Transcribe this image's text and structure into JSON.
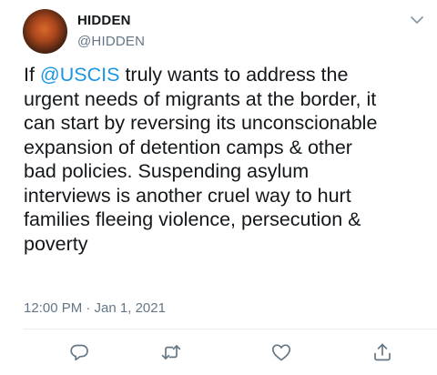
{
  "author": {
    "display_name": "HIDDEN",
    "handle": "@HIDDEN",
    "avatar_icon": "avatar-image"
  },
  "tweet": {
    "lines": [
      {
        "before": "If ",
        "mention": "@USCIS",
        "after": " truly wants to address the"
      },
      {
        "text": "urgent needs of migrants at the border, it"
      },
      {
        "text": "can start by reversing its unconscionable"
      },
      {
        "text": "expansion of detention camps & other"
      },
      {
        "text": "bad policies. Suspending asylum"
      },
      {
        "text": "interviews is another cruel way to hurt"
      },
      {
        "text": "families fleeing violence, persecution &"
      },
      {
        "text": "poverty"
      }
    ],
    "timestamp": "12:00 PM · Jan 1, 2021"
  },
  "actions": [
    "reply-icon",
    "retweet-icon",
    "like-icon",
    "share-icon"
  ],
  "colors": {
    "text": "#14171a",
    "secondary": "#657786",
    "mention": "#1b95e0",
    "divider": "#e6ecf0"
  }
}
